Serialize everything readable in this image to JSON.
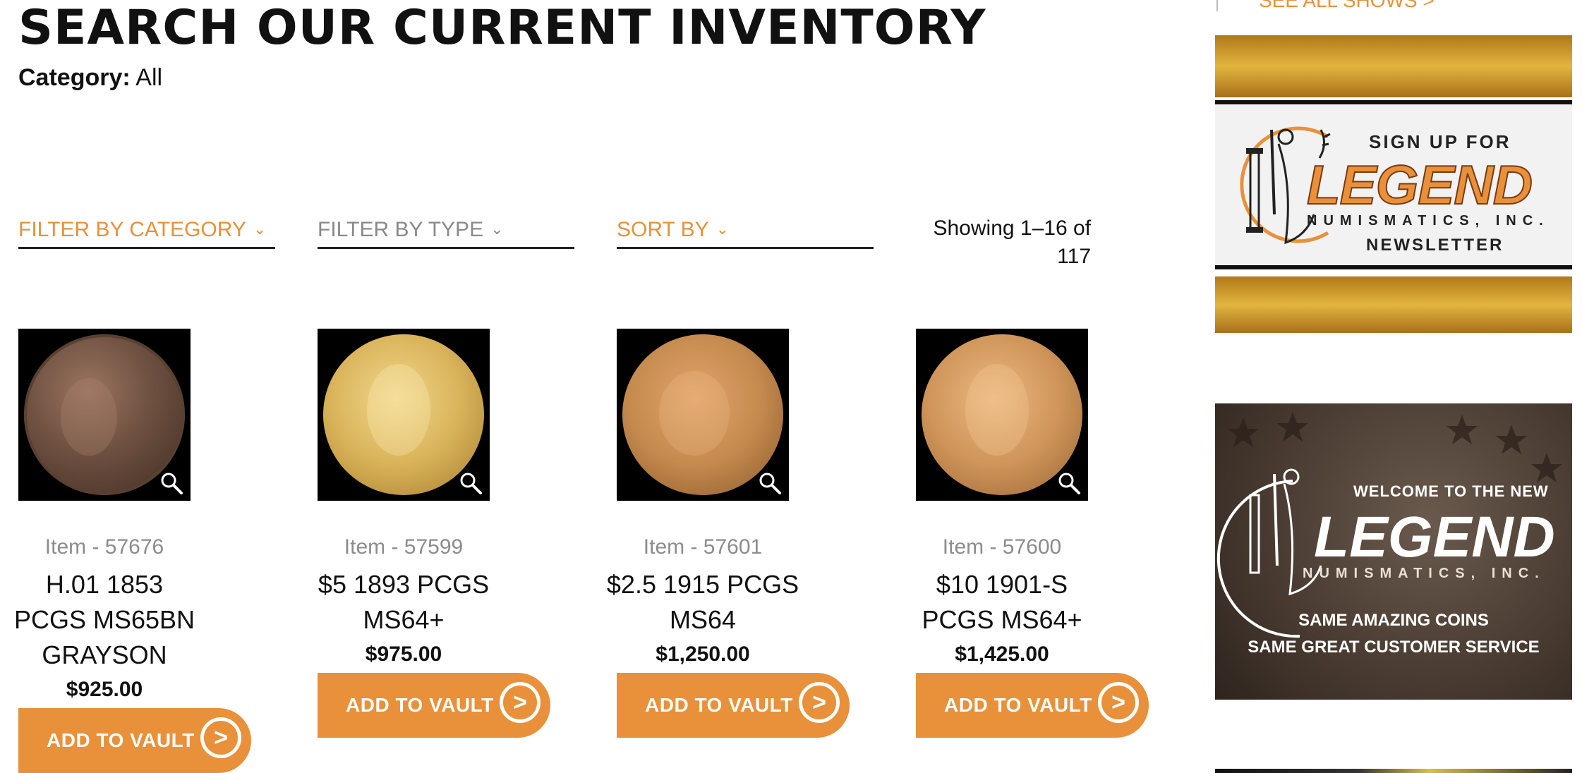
{
  "header": {
    "title": "SEARCH OUR CURRENT INVENTORY",
    "category_label": "Category:",
    "category_value": "All"
  },
  "filters": {
    "category": "FILTER BY CATEGORY",
    "type": "FILTER BY TYPE",
    "sort": "SORT BY",
    "showing_line1": "Showing 1–16 of",
    "showing_line2": "117"
  },
  "products": [
    {
      "item": "Item - 57676",
      "title_lines": [
        "H.01 1853",
        "PCGS MS65BN",
        "GRAYSON"
      ],
      "price": "$925.00",
      "button": "ADD TO VAULT",
      "coin_icon": "copper-half-cent-coin"
    },
    {
      "item": "Item - 57599",
      "title_lines": [
        "$5 1893 PCGS",
        "MS64+"
      ],
      "price": "$975.00",
      "button": "ADD TO VAULT",
      "coin_icon": "gold-liberty-coin"
    },
    {
      "item": "Item - 57601",
      "title_lines": [
        "$2.5 1915 PCGS",
        "MS64"
      ],
      "price": "$1,250.00",
      "button": "ADD TO VAULT",
      "coin_icon": "gold-indian-head-coin"
    },
    {
      "item": "Item - 57600",
      "title_lines": [
        "$10 1901-S",
        "PCGS MS64+"
      ],
      "price": "$1,425.00",
      "button": "ADD TO VAULT",
      "coin_icon": "gold-liberty-eagle-coin"
    }
  ],
  "sidebar": {
    "see_all": "SEE ALL SHOWS >",
    "newsletter": {
      "line1": "SIGN UP FOR",
      "brand": "LEGEND",
      "sub": "NUMISMATICS, INC.",
      "line3": "NEWSLETTER"
    },
    "welcome": {
      "line1": "WELCOME TO THE NEW",
      "brand": "LEGEND",
      "sub": "NUMISMATICS, INC.",
      "line2": "SAME AMAZING COINS",
      "line3": "SAME GREAT CUSTOMER SERVICE"
    }
  },
  "colors": {
    "accent": "#e8913a",
    "text": "#111111",
    "muted": "#8c8c8c"
  }
}
